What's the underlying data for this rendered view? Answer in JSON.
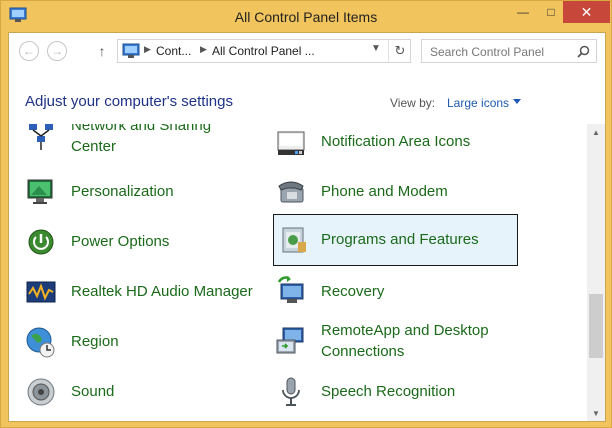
{
  "window": {
    "title": "All Control Panel Items",
    "minimize": "—",
    "maximize": "□",
    "close": "✕"
  },
  "nav": {
    "back": "←",
    "forward": "→",
    "up": "↑",
    "breadcrumbs": [
      "Cont...",
      "All Control Panel ..."
    ],
    "dropdown": "⌄",
    "refresh": "↻"
  },
  "search": {
    "placeholder": "Search Control Panel"
  },
  "header": {
    "title": "Adjust your computer's settings",
    "view_by_label": "View by:",
    "view_by_value": "Large icons"
  },
  "items": [
    {
      "label": "Network and Sharing Center",
      "icon": "network-icon",
      "column": 0
    },
    {
      "label": "Notification Area Icons",
      "icon": "notification-icon",
      "column": 1
    },
    {
      "label": "Personalization",
      "icon": "personalization-icon",
      "column": 0
    },
    {
      "label": "Phone and Modem",
      "icon": "phone-icon",
      "column": 1
    },
    {
      "label": "Power Options",
      "icon": "power-icon",
      "column": 0
    },
    {
      "label": "Programs and Features",
      "icon": "programs-icon",
      "column": 1,
      "selected": true
    },
    {
      "label": "Realtek HD Audio Manager",
      "icon": "realtek-audio-icon",
      "column": 0
    },
    {
      "label": "Recovery",
      "icon": "recovery-icon",
      "column": 1
    },
    {
      "label": "Region",
      "icon": "region-icon",
      "column": 0
    },
    {
      "label": "RemoteApp and Desktop Connections",
      "icon": "remoteapp-icon",
      "column": 1
    },
    {
      "label": "Sound",
      "icon": "sound-icon",
      "column": 0
    },
    {
      "label": "Speech Recognition",
      "icon": "microphone-icon",
      "column": 1
    }
  ],
  "colors": {
    "title_bar": "#f2c45d",
    "close_button": "#c7473b",
    "item_text": "#1a6a1a",
    "heading_text": "#1e3287",
    "link_text": "#1e5ab4",
    "selection_bg": "#e6f3fb"
  }
}
